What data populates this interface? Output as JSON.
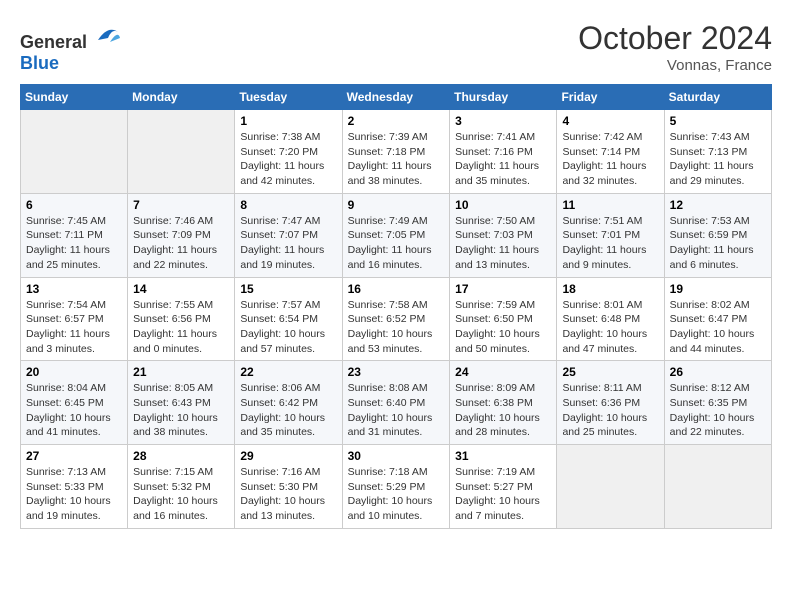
{
  "header": {
    "logo_general": "General",
    "logo_blue": "Blue",
    "month": "October 2024",
    "location": "Vonnas, France"
  },
  "days_of_week": [
    "Sunday",
    "Monday",
    "Tuesday",
    "Wednesday",
    "Thursday",
    "Friday",
    "Saturday"
  ],
  "weeks": [
    [
      {
        "day": "",
        "sunrise": "",
        "sunset": "",
        "daylight": "",
        "empty": true
      },
      {
        "day": "",
        "sunrise": "",
        "sunset": "",
        "daylight": "",
        "empty": true
      },
      {
        "day": "1",
        "sunrise": "Sunrise: 7:38 AM",
        "sunset": "Sunset: 7:20 PM",
        "daylight": "Daylight: 11 hours and 42 minutes.",
        "empty": false
      },
      {
        "day": "2",
        "sunrise": "Sunrise: 7:39 AM",
        "sunset": "Sunset: 7:18 PM",
        "daylight": "Daylight: 11 hours and 38 minutes.",
        "empty": false
      },
      {
        "day": "3",
        "sunrise": "Sunrise: 7:41 AM",
        "sunset": "Sunset: 7:16 PM",
        "daylight": "Daylight: 11 hours and 35 minutes.",
        "empty": false
      },
      {
        "day": "4",
        "sunrise": "Sunrise: 7:42 AM",
        "sunset": "Sunset: 7:14 PM",
        "daylight": "Daylight: 11 hours and 32 minutes.",
        "empty": false
      },
      {
        "day": "5",
        "sunrise": "Sunrise: 7:43 AM",
        "sunset": "Sunset: 7:13 PM",
        "daylight": "Daylight: 11 hours and 29 minutes.",
        "empty": false
      }
    ],
    [
      {
        "day": "6",
        "sunrise": "Sunrise: 7:45 AM",
        "sunset": "Sunset: 7:11 PM",
        "daylight": "Daylight: 11 hours and 25 minutes.",
        "empty": false
      },
      {
        "day": "7",
        "sunrise": "Sunrise: 7:46 AM",
        "sunset": "Sunset: 7:09 PM",
        "daylight": "Daylight: 11 hours and 22 minutes.",
        "empty": false
      },
      {
        "day": "8",
        "sunrise": "Sunrise: 7:47 AM",
        "sunset": "Sunset: 7:07 PM",
        "daylight": "Daylight: 11 hours and 19 minutes.",
        "empty": false
      },
      {
        "day": "9",
        "sunrise": "Sunrise: 7:49 AM",
        "sunset": "Sunset: 7:05 PM",
        "daylight": "Daylight: 11 hours and 16 minutes.",
        "empty": false
      },
      {
        "day": "10",
        "sunrise": "Sunrise: 7:50 AM",
        "sunset": "Sunset: 7:03 PM",
        "daylight": "Daylight: 11 hours and 13 minutes.",
        "empty": false
      },
      {
        "day": "11",
        "sunrise": "Sunrise: 7:51 AM",
        "sunset": "Sunset: 7:01 PM",
        "daylight": "Daylight: 11 hours and 9 minutes.",
        "empty": false
      },
      {
        "day": "12",
        "sunrise": "Sunrise: 7:53 AM",
        "sunset": "Sunset: 6:59 PM",
        "daylight": "Daylight: 11 hours and 6 minutes.",
        "empty": false
      }
    ],
    [
      {
        "day": "13",
        "sunrise": "Sunrise: 7:54 AM",
        "sunset": "Sunset: 6:57 PM",
        "daylight": "Daylight: 11 hours and 3 minutes.",
        "empty": false
      },
      {
        "day": "14",
        "sunrise": "Sunrise: 7:55 AM",
        "sunset": "Sunset: 6:56 PM",
        "daylight": "Daylight: 11 hours and 0 minutes.",
        "empty": false
      },
      {
        "day": "15",
        "sunrise": "Sunrise: 7:57 AM",
        "sunset": "Sunset: 6:54 PM",
        "daylight": "Daylight: 10 hours and 57 minutes.",
        "empty": false
      },
      {
        "day": "16",
        "sunrise": "Sunrise: 7:58 AM",
        "sunset": "Sunset: 6:52 PM",
        "daylight": "Daylight: 10 hours and 53 minutes.",
        "empty": false
      },
      {
        "day": "17",
        "sunrise": "Sunrise: 7:59 AM",
        "sunset": "Sunset: 6:50 PM",
        "daylight": "Daylight: 10 hours and 50 minutes.",
        "empty": false
      },
      {
        "day": "18",
        "sunrise": "Sunrise: 8:01 AM",
        "sunset": "Sunset: 6:48 PM",
        "daylight": "Daylight: 10 hours and 47 minutes.",
        "empty": false
      },
      {
        "day": "19",
        "sunrise": "Sunrise: 8:02 AM",
        "sunset": "Sunset: 6:47 PM",
        "daylight": "Daylight: 10 hours and 44 minutes.",
        "empty": false
      }
    ],
    [
      {
        "day": "20",
        "sunrise": "Sunrise: 8:04 AM",
        "sunset": "Sunset: 6:45 PM",
        "daylight": "Daylight: 10 hours and 41 minutes.",
        "empty": false
      },
      {
        "day": "21",
        "sunrise": "Sunrise: 8:05 AM",
        "sunset": "Sunset: 6:43 PM",
        "daylight": "Daylight: 10 hours and 38 minutes.",
        "empty": false
      },
      {
        "day": "22",
        "sunrise": "Sunrise: 8:06 AM",
        "sunset": "Sunset: 6:42 PM",
        "daylight": "Daylight: 10 hours and 35 minutes.",
        "empty": false
      },
      {
        "day": "23",
        "sunrise": "Sunrise: 8:08 AM",
        "sunset": "Sunset: 6:40 PM",
        "daylight": "Daylight: 10 hours and 31 minutes.",
        "empty": false
      },
      {
        "day": "24",
        "sunrise": "Sunrise: 8:09 AM",
        "sunset": "Sunset: 6:38 PM",
        "daylight": "Daylight: 10 hours and 28 minutes.",
        "empty": false
      },
      {
        "day": "25",
        "sunrise": "Sunrise: 8:11 AM",
        "sunset": "Sunset: 6:36 PM",
        "daylight": "Daylight: 10 hours and 25 minutes.",
        "empty": false
      },
      {
        "day": "26",
        "sunrise": "Sunrise: 8:12 AM",
        "sunset": "Sunset: 6:35 PM",
        "daylight": "Daylight: 10 hours and 22 minutes.",
        "empty": false
      }
    ],
    [
      {
        "day": "27",
        "sunrise": "Sunrise: 7:13 AM",
        "sunset": "Sunset: 5:33 PM",
        "daylight": "Daylight: 10 hours and 19 minutes.",
        "empty": false
      },
      {
        "day": "28",
        "sunrise": "Sunrise: 7:15 AM",
        "sunset": "Sunset: 5:32 PM",
        "daylight": "Daylight: 10 hours and 16 minutes.",
        "empty": false
      },
      {
        "day": "29",
        "sunrise": "Sunrise: 7:16 AM",
        "sunset": "Sunset: 5:30 PM",
        "daylight": "Daylight: 10 hours and 13 minutes.",
        "empty": false
      },
      {
        "day": "30",
        "sunrise": "Sunrise: 7:18 AM",
        "sunset": "Sunset: 5:29 PM",
        "daylight": "Daylight: 10 hours and 10 minutes.",
        "empty": false
      },
      {
        "day": "31",
        "sunrise": "Sunrise: 7:19 AM",
        "sunset": "Sunset: 5:27 PM",
        "daylight": "Daylight: 10 hours and 7 minutes.",
        "empty": false
      },
      {
        "day": "",
        "sunrise": "",
        "sunset": "",
        "daylight": "",
        "empty": true
      },
      {
        "day": "",
        "sunrise": "",
        "sunset": "",
        "daylight": "",
        "empty": true
      }
    ]
  ]
}
